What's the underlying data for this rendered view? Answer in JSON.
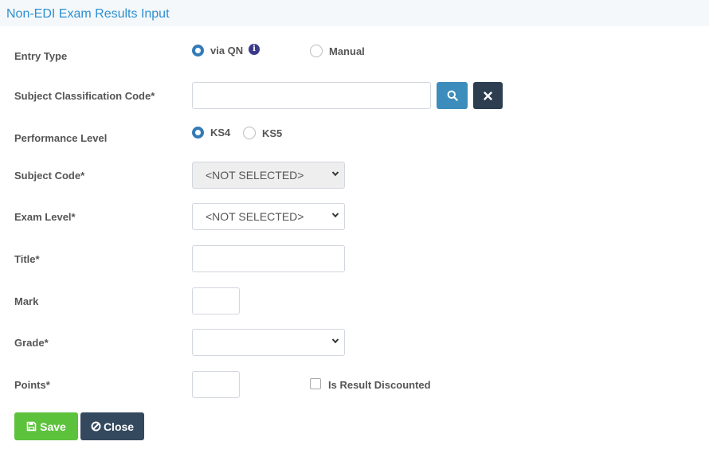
{
  "header": {
    "title": "Non-EDI Exam Results Input"
  },
  "entry_type": {
    "label": "Entry Type",
    "options": [
      {
        "label": "via QN",
        "checked": true
      },
      {
        "label": "Manual",
        "checked": false
      }
    ],
    "info_icon": "info-icon"
  },
  "subject_classification": {
    "label": "Subject Classification Code*",
    "value": "",
    "search_icon": "search-icon",
    "clear_icon": "close-icon"
  },
  "performance_level": {
    "label": "Performance Level",
    "options": [
      {
        "label": "KS4",
        "checked": true
      },
      {
        "label": "KS5",
        "checked": false
      }
    ]
  },
  "subject_code": {
    "label": "Subject Code*",
    "selected": "<NOT SELECTED>",
    "disabled": true
  },
  "exam_level": {
    "label": "Exam Level*",
    "selected": "<NOT SELECTED>"
  },
  "title_field": {
    "label": "Title*",
    "value": ""
  },
  "mark": {
    "label": "Mark",
    "value": ""
  },
  "grade": {
    "label": "Grade*",
    "selected": ""
  },
  "points": {
    "label": "Points*",
    "value": ""
  },
  "discounted": {
    "label": "Is Result Discounted",
    "checked": false
  },
  "buttons": {
    "save": {
      "label": "Save",
      "icon": "save-icon"
    },
    "close": {
      "label": "Close",
      "icon": "ban-icon"
    }
  },
  "colors": {
    "title_blue": "#2f8fcf",
    "search_btn": "#3c8dbc",
    "dark_btn": "#2c3e50",
    "save_btn": "#5cc23c",
    "radio_checked": "#337ab7"
  }
}
